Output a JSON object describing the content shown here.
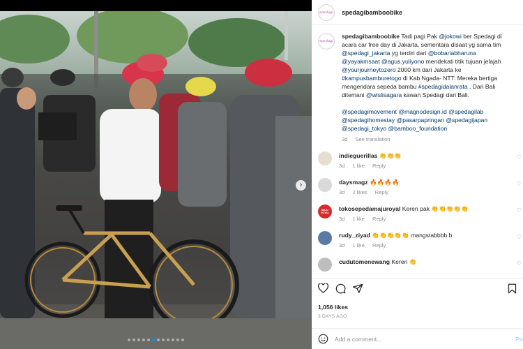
{
  "post": {
    "username": "spedagibamboobike",
    "avatar_text": "spedagi"
  },
  "caption": {
    "username": "spedagibamboobike",
    "text_1": "Tadi pagi Pak ",
    "mention_1": "@jokowi",
    "text_2": " ber Spedagi di acara car free day di Jakarta, sementara disaat yg sama tim ",
    "mention_2": "@spedagi_jakarta",
    "text_3": " yg terdiri dari ",
    "mention_3": "@bobariabharuna",
    "mention_4": "@yayakmsaat",
    "mention_5": "@agus.yuliyono",
    "text_4": " mendekati titik tujuan jelajah ",
    "mention_6": "@yourjourneytozero",
    "text_5": " 2000 km dari Jakarta ke ",
    "mention_7": "#kampusbamburetogo",
    "text_6": " di Kab Ngada- NTT. Mereka bertiga mengendara sepeda bambu ",
    "mention_8": "#spedagidalanrata",
    "text_7": " . Dari Bali ditemani ",
    "mention_9": "@wislisagara",
    "text_8": " kawan Spedagi dari Bali.",
    "tags_line_1": "@spedagimovement @magnodesign.id @spedagilab",
    "tags_line_2": "@spedagihomestay @pasarpapringan @spedagijapan",
    "tags_line_3": "@spedagi_tokyo @bamboo_foundation",
    "time": "3d",
    "see_translation": "See translation"
  },
  "comments": [
    {
      "username": "indieguerillas",
      "text": "👏👏👏",
      "time": "3d",
      "likes": "1 like",
      "reply": "Reply",
      "avatar_color": "#e8ded0"
    },
    {
      "username": "daysmagz",
      "text": "🔥🔥🔥🔥",
      "time": "3d",
      "likes": "2 likes",
      "reply": "Reply",
      "avatar_color": "#d9d9d9"
    },
    {
      "username": "tokosepedamajuroyal",
      "text": "Keren pak 👏👏👏👏👏",
      "time": "3d",
      "likes": "1 like",
      "reply": "Reply",
      "avatar_color": "#d62b2b",
      "avatar_text": "MAJU ROYAL"
    },
    {
      "username": "rudy_ziyad",
      "text": "👏👏👏👏👏 mangstabbbb b",
      "time": "3d",
      "likes": "1 like",
      "reply": "Reply",
      "avatar_color": "#5a7aa6"
    },
    {
      "username": "cudutomenewang",
      "text": "Keren 👏",
      "time": "",
      "likes": "",
      "reply": "",
      "avatar_color": "#bdbdbd"
    }
  ],
  "actions": {
    "likes_count": "1,056 likes",
    "posted_ago": "3 DAYS AGO"
  },
  "add_comment": {
    "placeholder": "Add a comment...",
    "post_label": "Po"
  },
  "carousel": {
    "total": 12,
    "active": 5
  }
}
